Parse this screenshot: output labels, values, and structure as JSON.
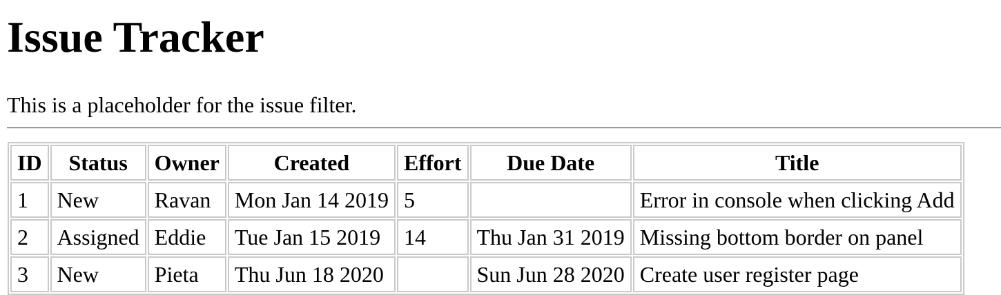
{
  "page": {
    "title": "Issue Tracker",
    "filter_placeholder": "This is a placeholder for the issue filter."
  },
  "table": {
    "headers": {
      "id": "ID",
      "status": "Status",
      "owner": "Owner",
      "created": "Created",
      "effort": "Effort",
      "due": "Due Date",
      "title": "Title"
    },
    "rows": [
      {
        "id": "1",
        "status": "New",
        "owner": "Ravan",
        "created": "Mon Jan 14 2019",
        "effort": "5",
        "due": "",
        "title": "Error in console when clicking Add"
      },
      {
        "id": "2",
        "status": "Assigned",
        "owner": "Eddie",
        "created": "Tue Jan 15 2019",
        "effort": "14",
        "due": "Thu Jan 31 2019",
        "title": "Missing bottom border on panel"
      },
      {
        "id": "3",
        "status": "New",
        "owner": "Pieta",
        "created": "Thu Jun 18 2020",
        "effort": "",
        "due": "Sun Jun 28 2020",
        "title": "Create user register page"
      }
    ]
  }
}
